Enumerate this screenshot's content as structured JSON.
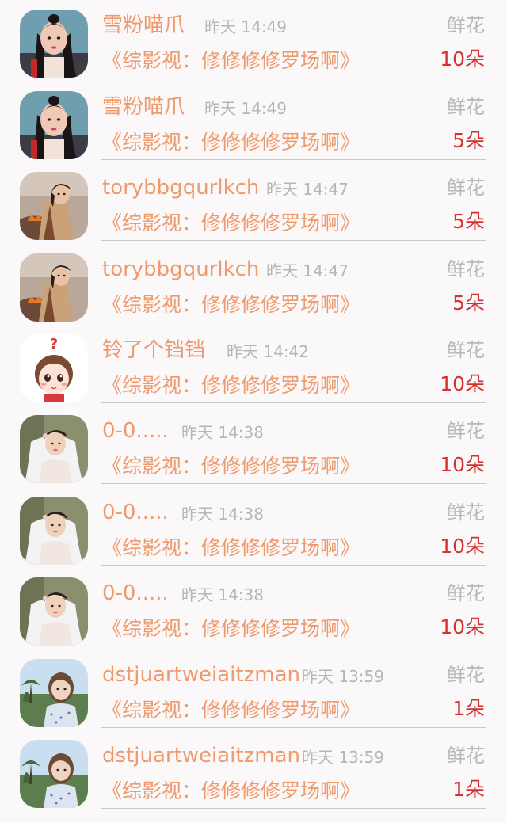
{
  "theme": {
    "username_color": "#ee9a6d",
    "time_color": "#b6b6b6",
    "count_color": "#d5312f",
    "divider_color": "#c9c9c9"
  },
  "records": [
    {
      "avatar": "avatar-ancient-costume-woman",
      "username": "雪粉喵爪",
      "time": "昨天 14:49",
      "gift": "鲜花",
      "book": "《综影视：修修修修罗场啊》",
      "count": "10朵"
    },
    {
      "avatar": "avatar-ancient-costume-woman",
      "username": "雪粉喵爪",
      "time": "昨天 14:49",
      "gift": "鲜花",
      "book": "《综影视：修修修修罗场啊》",
      "count": "5朵"
    },
    {
      "avatar": "avatar-woman-by-fire",
      "username": "torybbgqurlkch",
      "time": "昨天 14:47",
      "gift": "鲜花",
      "book": "《综影视：修修修修罗场啊》",
      "count": "5朵"
    },
    {
      "avatar": "avatar-woman-by-fire",
      "username": "torybbgqurlkch",
      "time": "昨天 14:47",
      "gift": "鲜花",
      "book": "《综影视：修修修修罗场啊》",
      "count": "5朵"
    },
    {
      "avatar": "avatar-cartoon-girl-question",
      "username": "铃了个铛铛",
      "time": "昨天 14:42",
      "gift": "鲜花",
      "book": "《综影视：修修修修罗场啊》",
      "count": "10朵"
    },
    {
      "avatar": "avatar-bride-veil",
      "username": "0-0.....",
      "time": "昨天 14:38",
      "gift": "鲜花",
      "book": "《综影视：修修修修罗场啊》",
      "count": "10朵"
    },
    {
      "avatar": "avatar-bride-veil",
      "username": "0-0.....",
      "time": "昨天 14:38",
      "gift": "鲜花",
      "book": "《综影视：修修修修罗场啊》",
      "count": "10朵"
    },
    {
      "avatar": "avatar-bride-veil",
      "username": "0-0.....",
      "time": "昨天 14:38",
      "gift": "鲜花",
      "book": "《综影视：修修修修罗场啊》",
      "count": "10朵"
    },
    {
      "avatar": "avatar-little-girl-outdoors",
      "username": "dstjuartweiaitzman",
      "time": "昨天 13:59",
      "gift": "鲜花",
      "book": "《综影视：修修修修罗场啊》",
      "count": "1朵"
    },
    {
      "avatar": "avatar-little-girl-outdoors",
      "username": "dstjuartweiaitzman",
      "time": "昨天 13:59",
      "gift": "鲜花",
      "book": "《综影视：修修修修罗场啊》",
      "count": "1朵"
    }
  ]
}
